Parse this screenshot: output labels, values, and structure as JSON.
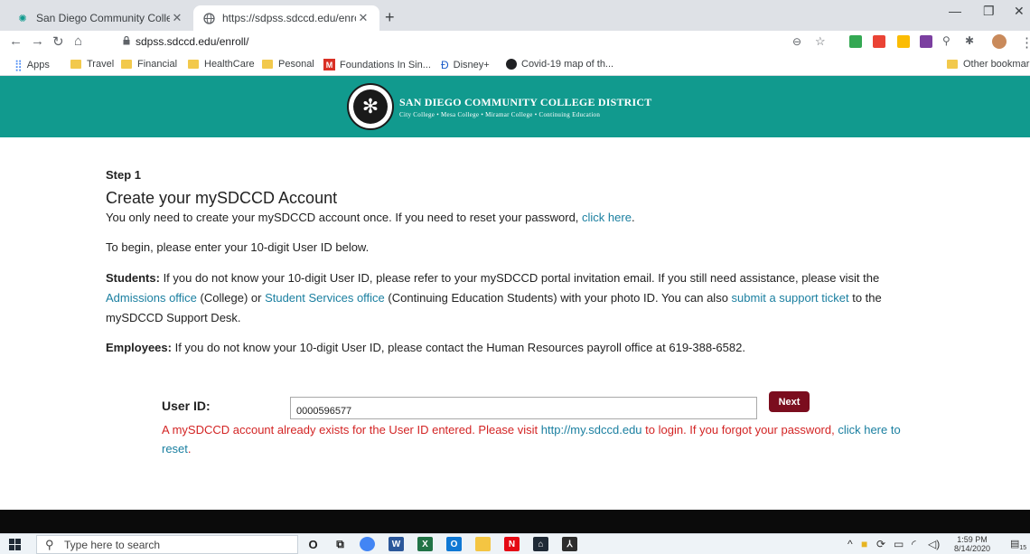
{
  "browser": {
    "tabs": [
      {
        "title": "San Diego Community College D",
        "active": false
      },
      {
        "title": "https://sdpss.sdccd.edu/enroll/",
        "active": true
      }
    ],
    "new_tab": "+",
    "url": "sdpss.sdccd.edu/enroll/",
    "bookmarks": [
      {
        "label": "Apps",
        "icon": "apps-grid-icon"
      },
      {
        "label": "Travel",
        "icon": "folder-icon"
      },
      {
        "label": "Financial",
        "icon": "folder-icon"
      },
      {
        "label": "HealthCare",
        "icon": "folder-icon"
      },
      {
        "label": "Pesonal",
        "icon": "folder-icon"
      },
      {
        "label": "Foundations In Sin...",
        "icon": "m-icon"
      },
      {
        "label": "Disney+",
        "icon": "disney-icon"
      },
      {
        "label": "Covid-19 map of th...",
        "icon": "covid-map-icon"
      }
    ],
    "other_bookmarks": "Other bookmarks"
  },
  "site": {
    "district": "SAN DIEGO COMMUNITY COLLEGE DISTRICT",
    "colleges": "City College  •  Mesa College  •  Miramar College  •  Continuing Education",
    "brand_color": "#119a8e"
  },
  "content": {
    "step": "Step 1",
    "heading": "Create your mySDCCD Account",
    "p1_text": "You only need to create your mySDCCD account once. If you need to reset your password, ",
    "p1_link": "click here",
    "p1_end": ".",
    "p2": "To begin, please enter your 10-digit User ID below.",
    "students_label": "Students:",
    "students_text1": " If you do not know your 10-digit User ID, please refer to your mySDCCD portal invitation email. If you still need assistance, please visit the ",
    "admissions_link": "Admissions office",
    "students_text2": " (College) or ",
    "services_link": "Student Services office",
    "students_text3": " (Continuing Education Students) with your photo ID.  You can also ",
    "ticket_link": "submit a support ticket",
    "students_text4": " to the mySDCCD Support Desk.",
    "employees_label": "Employees:",
    "employees_text": " If you do not know your 10-digit User ID, please contact the Human Resources payroll office at 619-388-6582.",
    "user_id_label": "User ID:",
    "user_id_value": "0000596577",
    "next_label": "Next",
    "error_text1": "A mySDCCD account already exists for the User ID entered.  Please visit ",
    "error_link1": "http://my.sdccd.edu",
    "error_text2": " to login. If you forgot your password, ",
    "error_link2": "click here to reset",
    "error_end": "."
  },
  "taskbar": {
    "search_placeholder": "Type here to search",
    "time": "1:59 PM",
    "date": "8/14/2020",
    "notification_count": "15"
  }
}
